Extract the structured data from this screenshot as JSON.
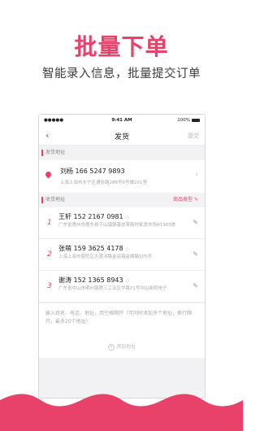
{
  "promo": {
    "title": "批量下单",
    "subtitle": "智能录入信息，批量提交订单"
  },
  "statusbar": {
    "signal": "●●●●● ",
    "time": "9:41 AM",
    "battery": "100%"
  },
  "navbar": {
    "back_icon": "‹",
    "title": "发货",
    "submit": "提交"
  },
  "sender_section": {
    "heading": "发货地址"
  },
  "sender": {
    "name_phone": "刘杨   166 5247 9893",
    "address": "上海上海市长宁区通协路288号6号楼201室"
  },
  "receiver_section": {
    "heading": "收货地址",
    "tag": "商品类型"
  },
  "receivers": [
    {
      "num": "1",
      "name_phone": "王轩   152 2167 0981",
      "address": "广东省惠州市惠东县平山镇银基皮革鞋材批发市场A1965栋"
    },
    {
      "num": "2",
      "name_phone": "张萌   159 3625 4178",
      "address": "上海上海市普陀区大渡河路金运路益阁路505号"
    },
    {
      "num": "3",
      "name_phone": "谢涛   152 1365 8943",
      "address": "广东省中山市明州镇第三工业区华路71号中山新阳电子"
    }
  ],
  "hint": {
    "text": "输入姓名、电话、地址，用空格隔开（可同时添加多个地址，换行隔开，最多20个地址）",
    "add_label": "添加地址"
  },
  "colors": {
    "accent": "#e8416a"
  }
}
